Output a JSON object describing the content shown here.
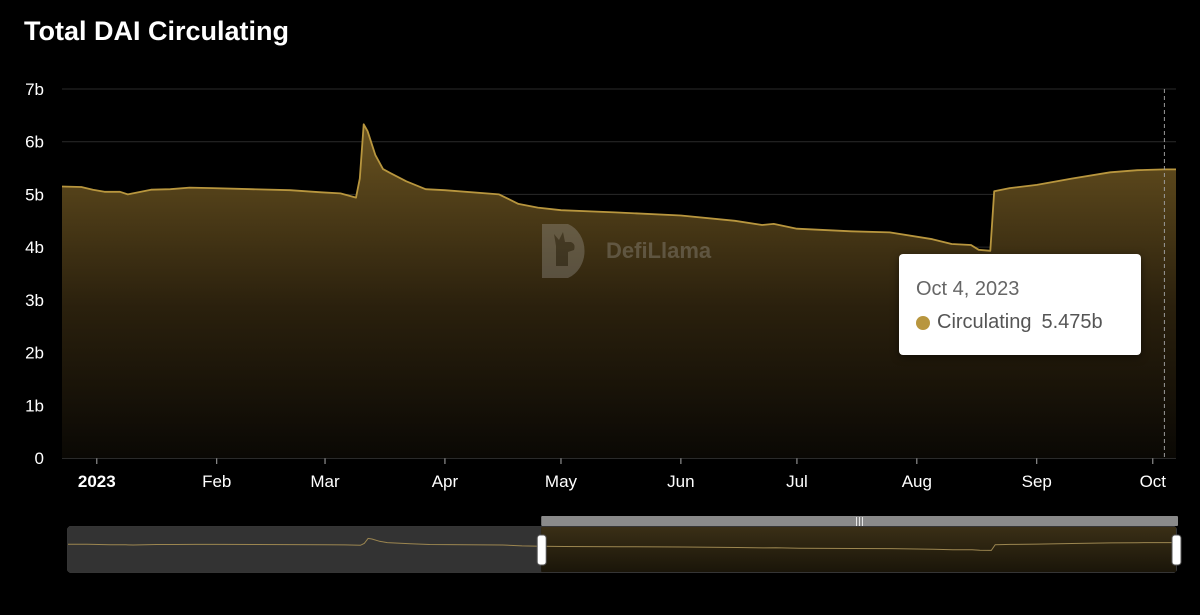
{
  "title": "Total DAI Circulating",
  "colors": {
    "series": "#b8963e",
    "background": "#000000",
    "grid": "#2a2a2a"
  },
  "watermark": {
    "text": "DefiLlama",
    "icon": "llama-logo-icon"
  },
  "tooltip": {
    "date": "Oct 4, 2023",
    "series_name": "Circulating",
    "value": "5.475b"
  },
  "chart_data": {
    "type": "area",
    "title": "Total DAI Circulating",
    "xlabel": "",
    "ylabel": "",
    "ylim": [
      0,
      7
    ],
    "y_unit": "b",
    "yticks": [
      "0",
      "1b",
      "2b",
      "3b",
      "4b",
      "5b",
      "6b",
      "7b"
    ],
    "xlim": [
      "2022-12-23",
      "2023-10-07"
    ],
    "xticks": [
      {
        "label": "2023",
        "date": "2023-01-01",
        "bold": true
      },
      {
        "label": "Feb",
        "date": "2023-02-01",
        "bold": false
      },
      {
        "label": "Mar",
        "date": "2023-03-01",
        "bold": false
      },
      {
        "label": "Apr",
        "date": "2023-04-01",
        "bold": false
      },
      {
        "label": "May",
        "date": "2023-05-01",
        "bold": false
      },
      {
        "label": "Jun",
        "date": "2023-06-01",
        "bold": false
      },
      {
        "label": "Jul",
        "date": "2023-07-01",
        "bold": false
      },
      {
        "label": "Aug",
        "date": "2023-08-01",
        "bold": false
      },
      {
        "label": "Sep",
        "date": "2023-09-01",
        "bold": false
      },
      {
        "label": "Oct",
        "date": "2023-10-01",
        "bold": false
      }
    ],
    "grid": true,
    "series": [
      {
        "name": "Circulating",
        "x": [
          "2022-12-23",
          "2022-12-28",
          "2022-12-31",
          "2023-01-03",
          "2023-01-07",
          "2023-01-09",
          "2023-01-15",
          "2023-01-20",
          "2023-01-25",
          "2023-01-31",
          "2023-02-10",
          "2023-02-20",
          "2023-02-28",
          "2023-03-05",
          "2023-03-09",
          "2023-03-10",
          "2023-03-11",
          "2023-03-12",
          "2023-03-14",
          "2023-03-16",
          "2023-03-18",
          "2023-03-22",
          "2023-03-27",
          "2023-04-01",
          "2023-04-15",
          "2023-04-20",
          "2023-04-25",
          "2023-05-01",
          "2023-05-15",
          "2023-06-01",
          "2023-06-15",
          "2023-06-22",
          "2023-06-25",
          "2023-07-01",
          "2023-07-15",
          "2023-07-25",
          "2023-08-05",
          "2023-08-10",
          "2023-08-15",
          "2023-08-17",
          "2023-08-20",
          "2023-08-21",
          "2023-08-25",
          "2023-09-01",
          "2023-09-10",
          "2023-09-20",
          "2023-09-27",
          "2023-10-04",
          "2023-10-07"
        ],
        "y": [
          5.15,
          5.14,
          5.09,
          5.05,
          5.05,
          5.0,
          5.09,
          5.1,
          5.13,
          5.12,
          5.1,
          5.08,
          5.04,
          5.02,
          4.94,
          5.3,
          6.33,
          6.2,
          5.75,
          5.48,
          5.4,
          5.25,
          5.1,
          5.08,
          5.0,
          4.82,
          4.75,
          4.7,
          4.66,
          4.6,
          4.5,
          4.42,
          4.44,
          4.35,
          4.3,
          4.28,
          4.15,
          4.06,
          4.04,
          3.95,
          3.93,
          5.06,
          5.12,
          5.18,
          5.3,
          5.42,
          5.46,
          5.475,
          5.475
        ]
      }
    ],
    "hover": {
      "date": "2023-10-04",
      "value": 5.475
    },
    "brush": {
      "from": "2023-04-25",
      "to": "2023-10-07"
    }
  }
}
